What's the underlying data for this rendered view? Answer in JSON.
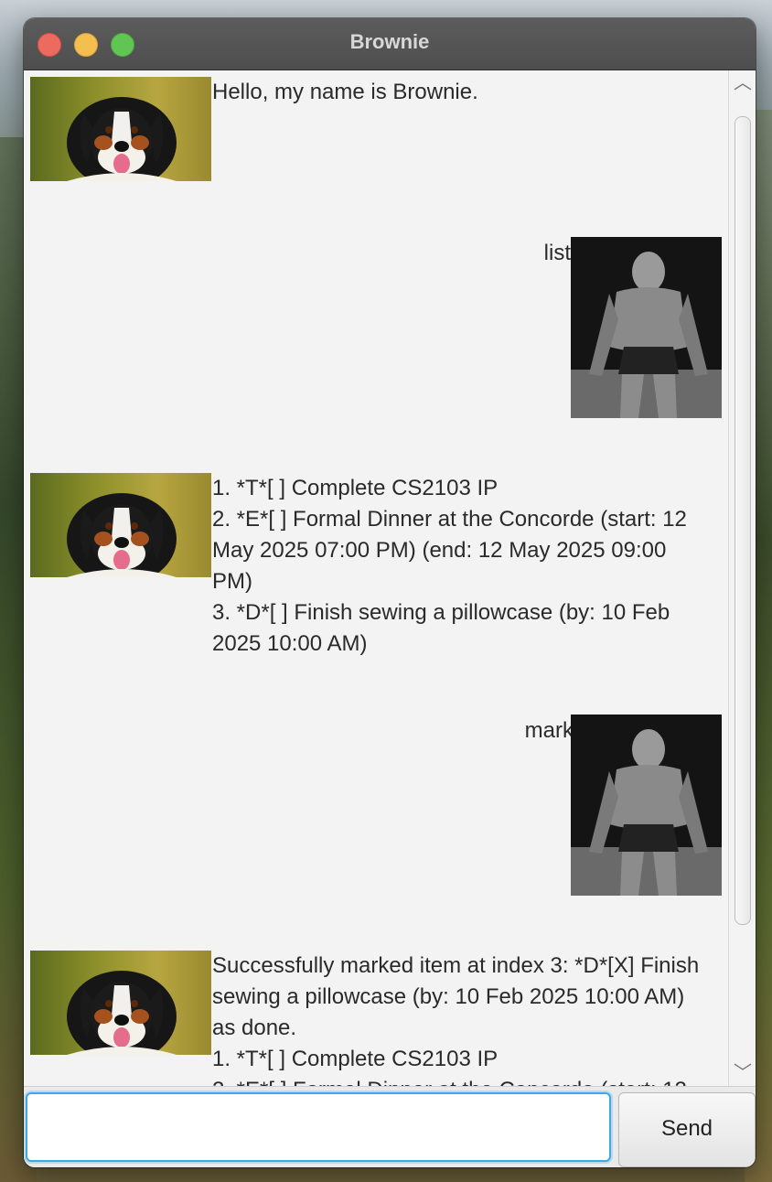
{
  "window": {
    "title": "Brownie"
  },
  "messages": [
    {
      "sender": "bot",
      "text": "Hello, my name is Brownie."
    },
    {
      "sender": "user",
      "text": "list"
    },
    {
      "sender": "bot",
      "text": "1. *T*[ ] Complete CS2103 IP\n2. *E*[ ] Formal Dinner at the Concorde (start: 12\nMay 2025 07:00 PM) (end: 12 May 2025 09:00\nPM)\n3. *D*[ ] Finish sewing a pillowcase (by: 10 Feb\n2025 10:00 AM)"
    },
    {
      "sender": "user",
      "text": "mark 3"
    },
    {
      "sender": "bot",
      "text": "Successfully marked item at index 3: *D*[X] Finish\nsewing a pillowcase (by: 10 Feb 2025 10:00 AM)\nas done.\n1. *T*[ ] Complete CS2103 IP\n2. *E*[ ] Formal Dinner at the Concorde (start: 12"
    }
  ],
  "input": {
    "value": "",
    "placeholder": ""
  },
  "send_button": {
    "label": "Send"
  },
  "scrollbar": {
    "up_glyph": "︿",
    "down_glyph": "﹀"
  },
  "colors": {
    "titlebar": "#555555",
    "close": "#ed6a5e",
    "minimize": "#f5bf4f",
    "maximize": "#61c554",
    "input_focus": "#3fa9e8",
    "dialog_bg": "#f3f3f3"
  }
}
